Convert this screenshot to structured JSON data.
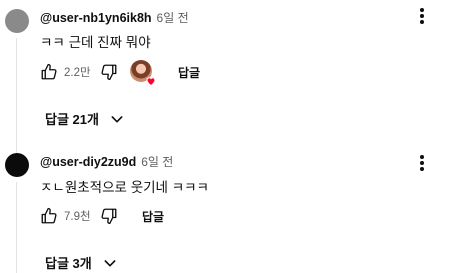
{
  "comments": [
    {
      "author": "@user-nb1yn6ik8h",
      "time": "6일 전",
      "text": "ㅋㅋ 근데 진짜 뭐야",
      "likes": "2.2만",
      "creator_hearted": true,
      "reply_label": "답글",
      "replies_label": "답글 21개"
    },
    {
      "author": "@user-diy2zu9d",
      "time": "6일 전",
      "text": "ㅈㄴ원초적으로 웃기네 ㅋㅋㅋ",
      "likes": "7.9천",
      "creator_hearted": false,
      "reply_label": "답글",
      "replies_label": "답글 3개"
    }
  ],
  "icons": {
    "like": "thumbs-up-icon",
    "dislike": "thumbs-down-icon",
    "menu": "more-vertical-icon",
    "expand": "chevron-down-icon",
    "heart": "heart-icon"
  },
  "colors": {
    "heart": "#ff0033",
    "secondary_text": "#606060"
  }
}
